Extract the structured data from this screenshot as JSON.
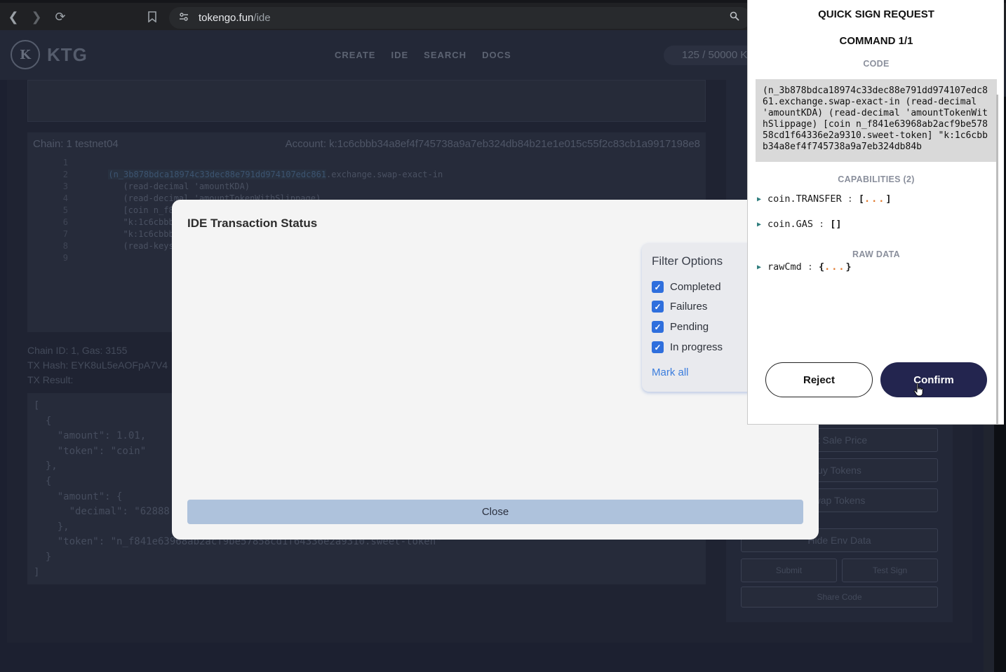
{
  "browser": {
    "url_host": "tokengo.fun",
    "url_path": "/ide"
  },
  "site": {
    "logo_letter": "K",
    "logo_text": "KTG",
    "nav": [
      "CREATE",
      "IDE",
      "SEARCH",
      "DOCS"
    ],
    "counter": "125 / 50000 K"
  },
  "editor": {
    "chain_label": "Chain: 1 testnet04",
    "account_label": "Account: k:1c6cbbb34a8ef4f745738a9a7eb324db84b21e1e015c55f2c83cb1a9917198e8",
    "lines": [
      {
        "num": "1",
        "text": ""
      },
      {
        "num": "2",
        "hl": "(n_3b878bdca18974c33dec88e791dd974107edc861",
        "text": ".exchange.swap-exact-in"
      },
      {
        "num": "3",
        "text": "  (read-decimal 'amountKDA)"
      },
      {
        "num": "4",
        "text": "  (read-decimal 'amountTokenWithSlippage)"
      },
      {
        "num": "5",
        "text": "  [coin n_f8"
      },
      {
        "num": "6",
        "text": "  \"k:1c6cbbb"
      },
      {
        "num": "7",
        "text": "  \"k:1c6cbbb"
      },
      {
        "num": "8",
        "text": "  (read-keys"
      },
      {
        "num": "9",
        "text": ""
      }
    ]
  },
  "tx": {
    "chain_gas": "Chain ID: 1, Gas: 3155",
    "hash": "TX Hash: EYK8uL5eAOFpA7V4",
    "result_label": "TX Result:",
    "result_json": "[\n  {\n    \"amount\": 1.01,\n    \"token\": \"coin\"\n  },\n  {\n    \"amount\": {\n      \"decimal\": \"62888\n    },\n    \"token\": \"n_f841e63968ab2acf9be57858cd1f64336e2a9310.sweet-token\"\n  }\n]"
  },
  "side": {
    "buttons": [
      "nt Sale Price",
      "uy Tokens",
      "wap Tokens",
      "Hide Env Data"
    ],
    "submit": "Submit",
    "test_sign": "Test Sign",
    "share": "Share Code"
  },
  "modal": {
    "title": "IDE Transaction Status",
    "filter_title": "Filter Options",
    "filters": [
      {
        "label": "Completed",
        "checked": true
      },
      {
        "label": "Failures",
        "checked": true
      },
      {
        "label": "Pending",
        "checked": true
      },
      {
        "label": "In progress",
        "checked": true
      }
    ],
    "mark_all": "Mark all",
    "close": "Close"
  },
  "wallet": {
    "title": "QUICK SIGN REQUEST",
    "command": "COMMAND 1/1",
    "code_label": "CODE",
    "code": "(n_3b878bdca18974c33dec88e791dd974107edc861.exchange.swap-exact-in (read-decimal 'amountKDA) (read-decimal 'amountTokenWithSlippage) [coin n_f841e63968ab2acf9be57858cd1f64336e2a9310.sweet-token] \"k:1c6cbbb34a8ef4f745738a9a7eb324db84b",
    "capabilities_label": "CAPABILITIES (2)",
    "capabilities": [
      {
        "name": "coin.TRANSFER",
        "open": "[",
        "dots": "...",
        "close": "]"
      },
      {
        "name": "coin.GAS",
        "open": "[",
        "dots": "",
        "close": "]"
      }
    ],
    "raw_label": "RAW DATA",
    "raw": {
      "name": "rawCmd",
      "open": "{",
      "dots": "...",
      "close": "}"
    },
    "reject": "Reject",
    "confirm": "Confirm"
  }
}
